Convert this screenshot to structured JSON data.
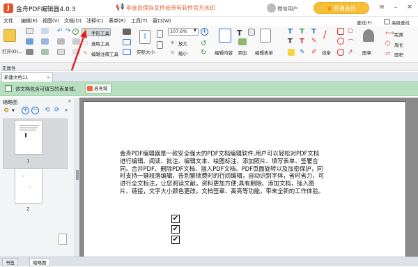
{
  "titlebar": {
    "app_title": "金舟PDF编辑器4.0.3",
    "promo": "非会员保存文件会带有软件官方水印",
    "wechat_user": "微信用户",
    "vip_button": "开通会员"
  },
  "menu": [
    "文件",
    "编辑(E)",
    "视图(V)",
    "文档(D)",
    "注释(C)",
    "表单(R)",
    "工具(T)",
    "窗口(W)"
  ],
  "toolbar": {
    "open": "打开(O)...",
    "hand_tool": "手形工具",
    "select_tool": "选取工具",
    "edit_annot_tool": "编辑注释工具",
    "actual_size": "实际大小",
    "zoom": "107.6%",
    "zoom_in": "放大",
    "zoom_out": "缩小",
    "edit_content": "编辑内容",
    "add": "添加",
    "edit_form": "编辑表单",
    "line": "线条",
    "stamp": "图章",
    "search": "查找(F)",
    "adv_search": "高级查找",
    "distance": "距离",
    "perimeter": "周长",
    "area": "面积"
  },
  "properties_label": "无属性",
  "document_tab": "新建文档11",
  "notice": {
    "text": "该文档包含可填写的表单域。",
    "highlight": "高亮域"
  },
  "sidebar": {
    "title": "缩略图",
    "pages": [
      "1",
      "2"
    ]
  },
  "bottom_tabs": [
    "书签",
    "缩略图"
  ],
  "document": {
    "paragraph": "金舟PDF编辑器是一款安全强大的PDF文档编辑软件,用户可以轻松对PDF文档\n进行编辑、阅读、批注、编辑文本、绘图标注、添加照片、填写表单、签署合\n同、合并PDF、删除PDF文档、插入PDF文档、PDF页面旋转以及加密保护，同\n时支持一键段落编辑，告别繁琐费时的行间编辑，自动识别字体，省时省力，可\n进行全文标注，让您阅读文献，资料更加方便;具有删除、添加文档，插入图\n片、链接，文字大小颜色更改，文档签章、高亮等功能，带来全新的工作体验。",
    "checkbox_mark": "✔"
  },
  "colors": {
    "accent": "#e8522f",
    "vip": "#f5c037",
    "notice_bg": "#b8e0c0",
    "arrow": "#e02020"
  }
}
